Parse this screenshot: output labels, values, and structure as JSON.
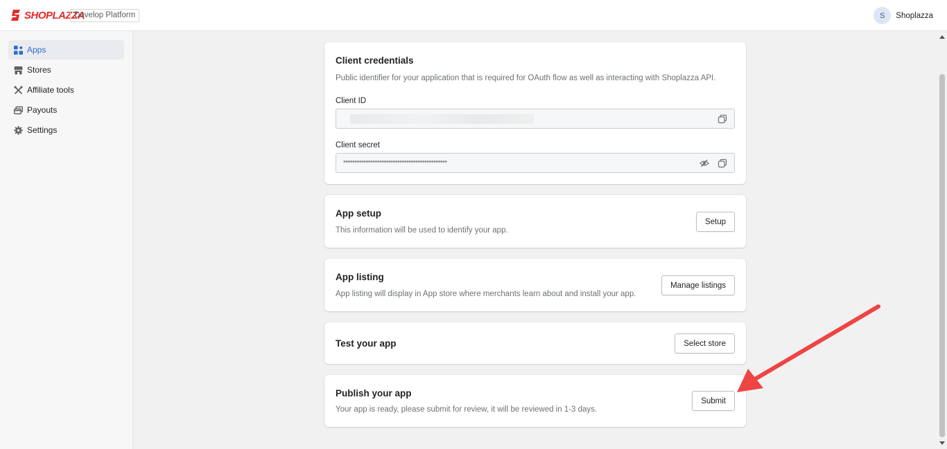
{
  "header": {
    "logo_text": "SHOPLAZZA",
    "platform_tag": "Develop Platform",
    "avatar_initial": "S",
    "user_name": "Shoplazza"
  },
  "sidebar": {
    "items": [
      {
        "label": "Apps",
        "icon": "apps-grid-icon",
        "active": true
      },
      {
        "label": "Stores",
        "icon": "store-icon",
        "active": false
      },
      {
        "label": "Affiliate tools",
        "icon": "tools-icon",
        "active": false
      },
      {
        "label": "Payouts",
        "icon": "payouts-icon",
        "active": false
      },
      {
        "label": "Settings",
        "icon": "gear-icon",
        "active": false
      }
    ]
  },
  "credentials": {
    "title": "Client credentials",
    "description": "Public identifier for your application that is required for OAuth flow as well as interacting with Shoplazza API.",
    "client_id_label": "Client ID",
    "client_secret_label": "Client secret",
    "client_secret_value": "••••••••••••••••••••••••••••••••••••••••••••••"
  },
  "app_setup": {
    "title": "App setup",
    "description": "This information will be used to identify your app.",
    "button": "Setup"
  },
  "app_listing": {
    "title": "App listing",
    "description": "App listing will display in App store where merchants learn about and install your app.",
    "button": "Manage listings"
  },
  "test_app": {
    "title": "Test your app",
    "button": "Select store"
  },
  "publish": {
    "title": "Publish your app",
    "description": "Your app is ready, please submit for review, it will be reviewed in 1-3 days.",
    "button": "Submit"
  },
  "colors": {
    "brand": "#e32a2a",
    "active_nav": "#2c6ecb",
    "annotation_arrow": "#ef4444"
  }
}
